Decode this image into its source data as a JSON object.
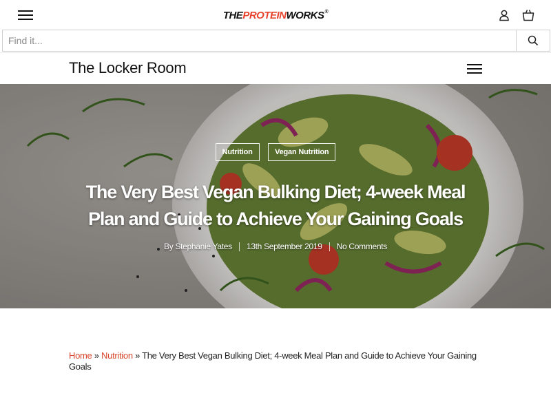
{
  "header": {
    "logo": {
      "part1": "THE",
      "part2": "PROTEIN",
      "part3": "WORKS",
      "mark": "®"
    },
    "icons": {
      "menu": "hamburger-icon",
      "account": "user-icon",
      "basket": "basket-icon"
    }
  },
  "search": {
    "placeholder": "Find it...",
    "button_icon": "search-icon"
  },
  "locker": {
    "title": "The Locker Room",
    "menu_icon": "hamburger-icon"
  },
  "hero": {
    "tags": [
      "Nutrition",
      "Vegan Nutrition"
    ],
    "title": "The Very Best Vegan Bulking Diet; 4-week Meal Plan and Guide to Achieve Your Gaining Goals",
    "author": "By Stephanie Yates",
    "date": "13th September 2019",
    "comments": "No Comments"
  },
  "breadcrumb": {
    "home": "Home",
    "sep": "»",
    "category": "Nutrition",
    "current": "The Very Best Vegan Bulking Diet; 4-week Meal Plan and Guide to Achieve Your Gaining Goals"
  },
  "colors": {
    "accent": "#e8432d",
    "link": "#d9452b",
    "text": "#111111"
  }
}
